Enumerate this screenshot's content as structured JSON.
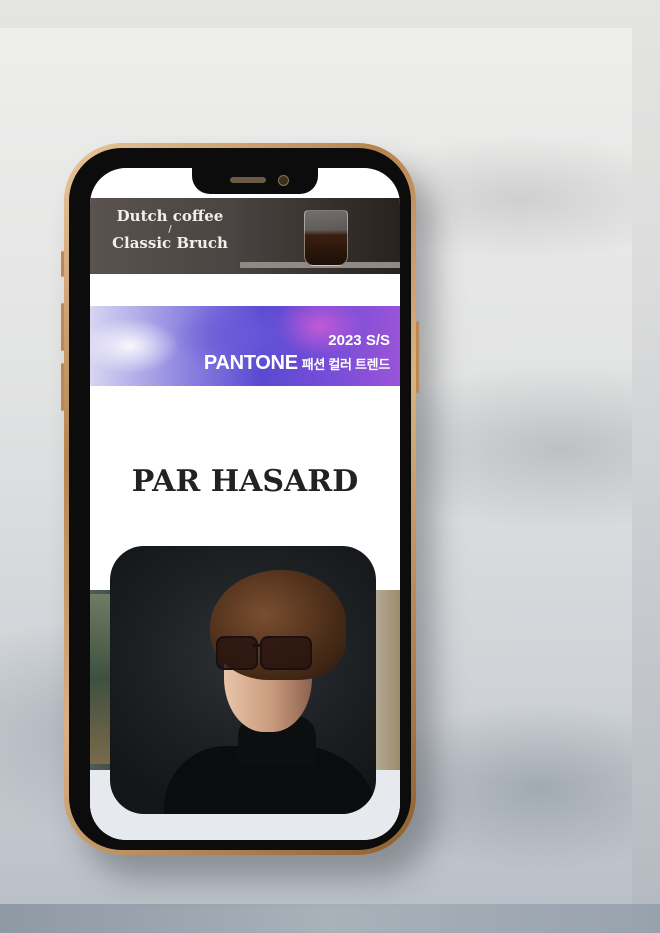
{
  "screen": {
    "banner_coffee": {
      "line1": "Dutch coffee",
      "separator": "/",
      "line2": "Classic Bruch"
    },
    "banner_pantone": {
      "year": "2023 S/S",
      "brand": "PANTONE",
      "subtitle": "패션 컬러 트렌드"
    },
    "brand_title": "PAR HASARD"
  },
  "colors": {
    "phone_frame": "#b5854f",
    "title_text": "#222222"
  }
}
